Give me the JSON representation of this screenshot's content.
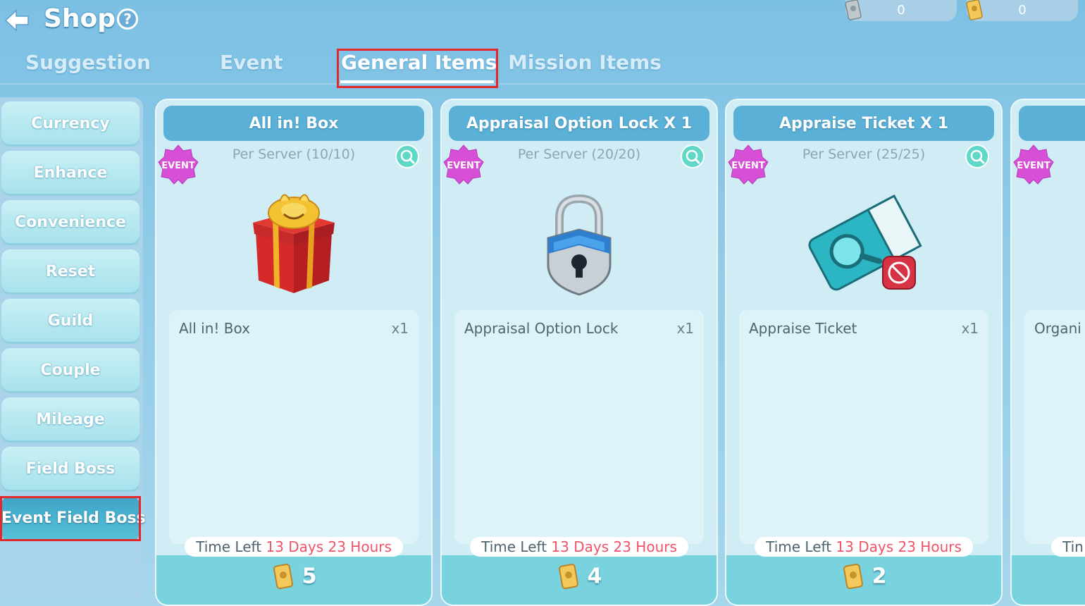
{
  "header": {
    "title": "Shop",
    "help": "?"
  },
  "currencies": [
    {
      "value": "0"
    },
    {
      "value": "0"
    }
  ],
  "tabs": [
    {
      "label": "Suggestion"
    },
    {
      "label": "Event"
    },
    {
      "label": "General Items"
    },
    {
      "label": "Mission Items"
    }
  ],
  "sidebar": {
    "items": [
      {
        "label": "Currency"
      },
      {
        "label": "Enhance"
      },
      {
        "label": "Convenience"
      },
      {
        "label": "Reset"
      },
      {
        "label": "Guild"
      },
      {
        "label": "Couple"
      },
      {
        "label": "Mileage"
      },
      {
        "label": "Field Boss"
      },
      {
        "label": "Event Field Boss"
      }
    ]
  },
  "cards": [
    {
      "title": "All in! Box",
      "badge": "EVENT",
      "limit": "Per Server (10/10)",
      "item_name": "All in! Box",
      "qty": "x1",
      "time_prefix": "Time Left",
      "time_value": "13 Days 23 Hours",
      "price": "5"
    },
    {
      "title": "Appraisal Option Lock X 1",
      "badge": "EVENT",
      "limit": "Per Server (20/20)",
      "item_name": "Appraisal Option Lock",
      "qty": "x1",
      "time_prefix": "Time Left",
      "time_value": "13 Days 23 Hours",
      "price": "4"
    },
    {
      "title": "Appraise Ticket X 1",
      "badge": "EVENT",
      "limit": "Per Server (25/25)",
      "item_name": "Appraise Ticket",
      "qty": "x1",
      "time_prefix": "Time Left",
      "time_value": "13 Days 23 Hours",
      "price": "2"
    },
    {
      "title": "",
      "badge": "EVENT",
      "item_name": "Organi",
      "time_prefix": "Tin"
    }
  ],
  "colors": {
    "accent": "#5ab0d6",
    "time_red": "#ee5468",
    "highlight_box": "#e5262b",
    "active_sidebar": "#3fa2c8"
  }
}
